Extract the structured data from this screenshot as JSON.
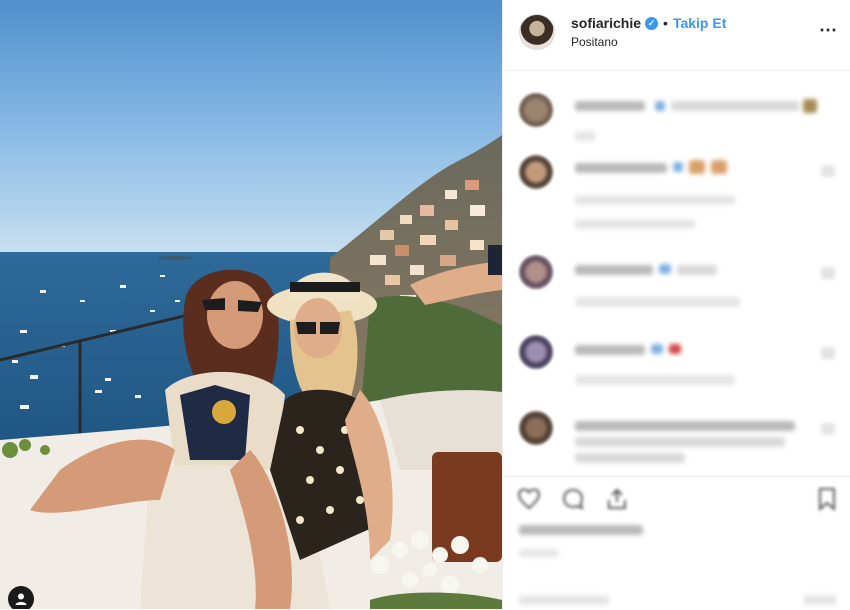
{
  "post": {
    "username": "sofiarichie",
    "verified_mark": "✓",
    "separator": "•",
    "follow_label": "Takip Et",
    "location": "Positano",
    "more_icon": "⋯"
  },
  "icons": {
    "like": "heart-icon",
    "comment": "comment-icon",
    "share": "share-icon",
    "save": "bookmark-icon",
    "user_tag": "user-icon"
  },
  "colors": {
    "accent": "#3897f0",
    "text": "#262626",
    "border": "#efefef"
  }
}
